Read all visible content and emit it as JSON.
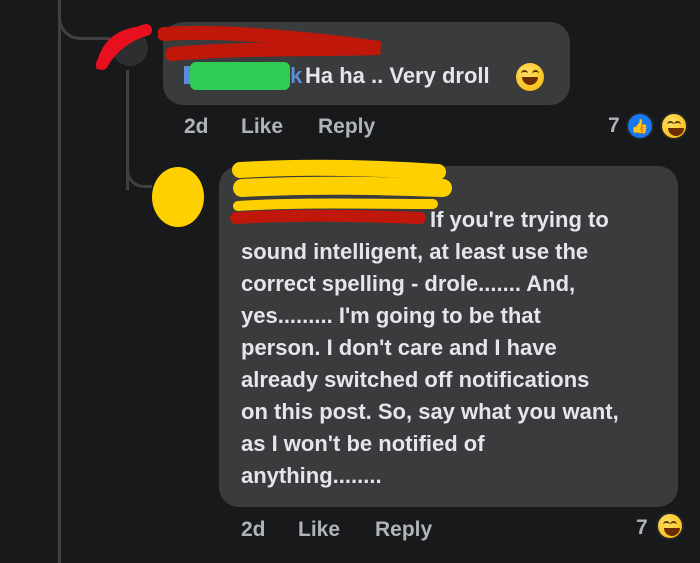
{
  "comment1": {
    "name_tail": "k",
    "text": "Ha ha .. Very droll",
    "time": "2d",
    "like_label": "Like",
    "reply_label": "Reply",
    "reaction_count": "7",
    "reactions": [
      "like-icon",
      "laughing-emoji-icon"
    ]
  },
  "comment2": {
    "text_lines": [
      "If you're trying to",
      "sound intelligent, at least use the",
      "correct spelling - drole....... And,",
      "yes......... I'm going to be that",
      "person.  I don't care and I have",
      "already switched off notifications",
      "on this post. So, say what you want,",
      "as I won't be notified of",
      "anything........"
    ],
    "time": "2d",
    "like_label": "Like",
    "reply_label": "Reply",
    "reaction_count": "7",
    "reactions": [
      "laughing-emoji-icon"
    ]
  },
  "colors": {
    "background": "#18191a",
    "bubble": "#3a3b3c",
    "text": "#e4e6eb",
    "secondary_text": "#b0b3b8",
    "like_blue": "#1877f2",
    "redaction_red": "#c0170b",
    "redaction_green": "#2ecc52",
    "redaction_yellow": "#ffd000"
  }
}
